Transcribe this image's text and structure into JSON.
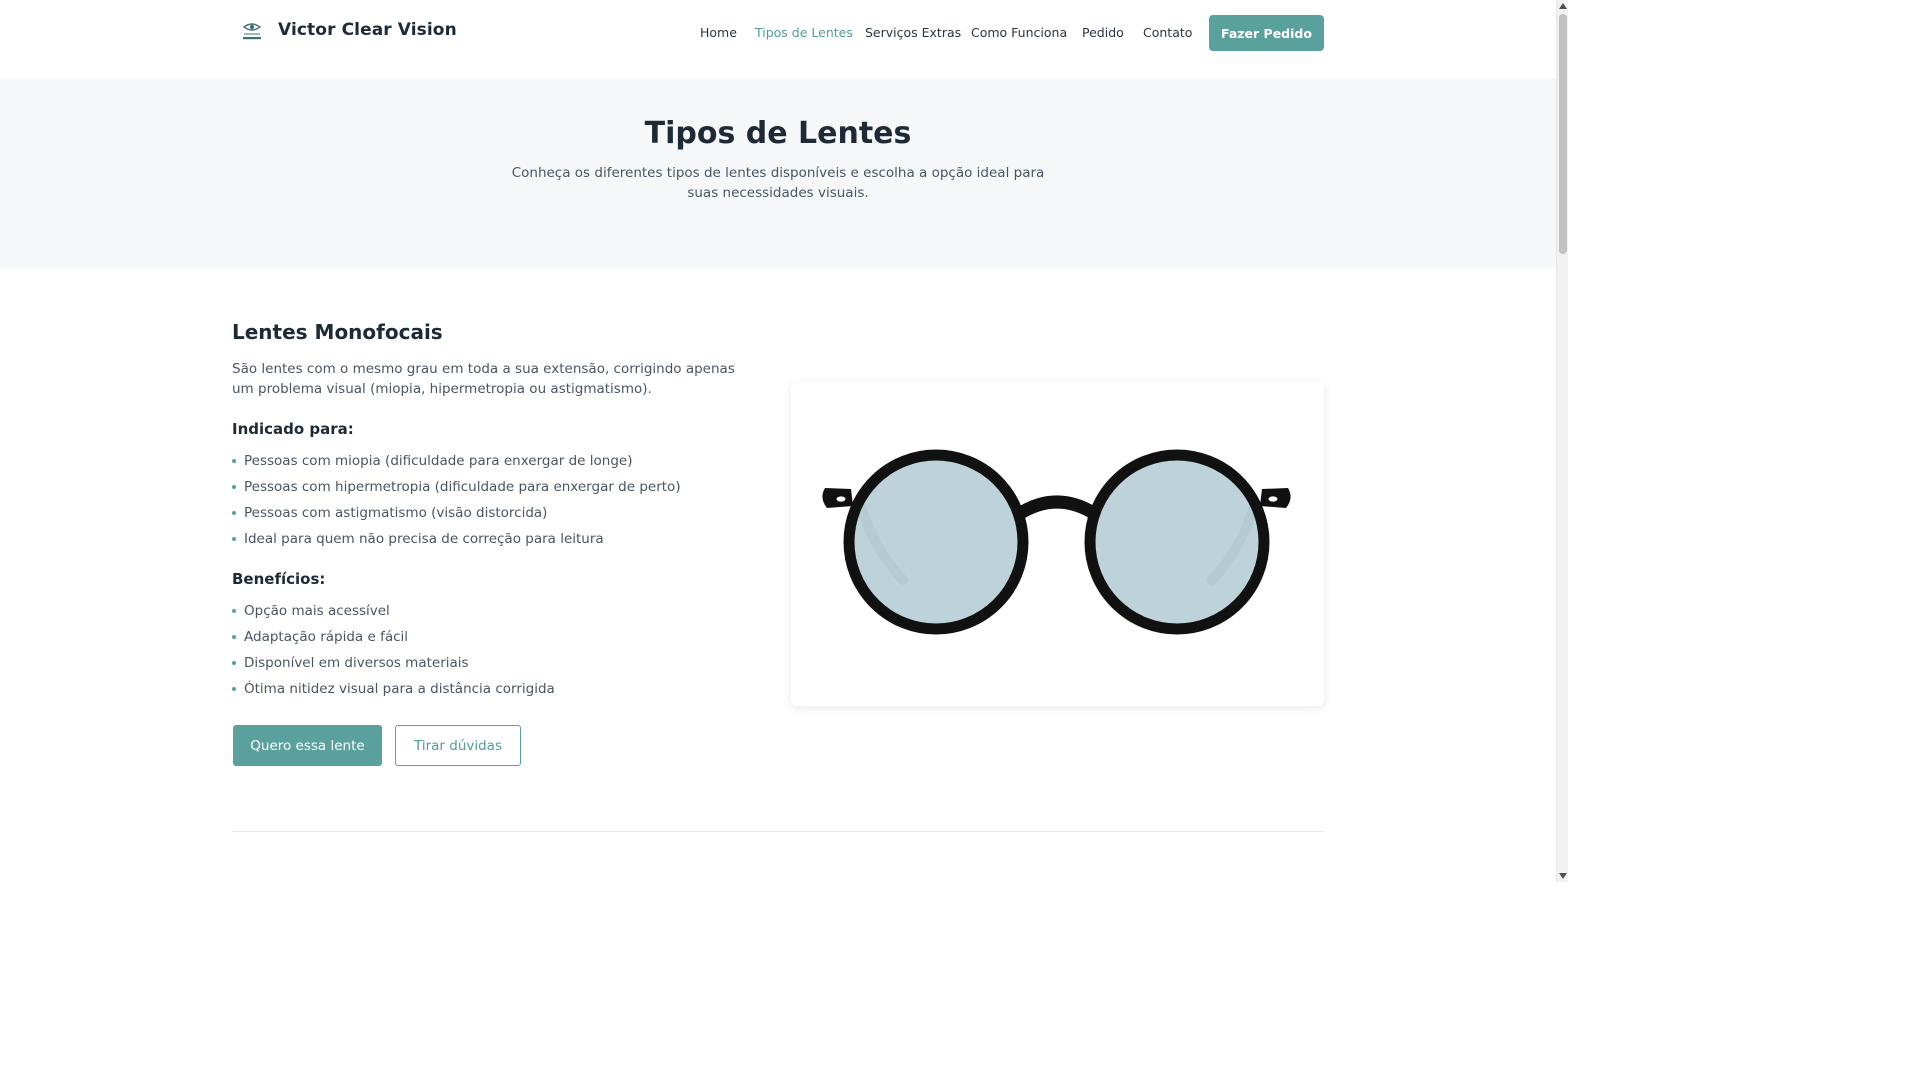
{
  "header": {
    "brand": "Victor Clear Vision",
    "logo_icon": "eye-logo-icon",
    "nav": [
      {
        "label": "Home",
        "active": false
      },
      {
        "label": "Tipos de Lentes",
        "active": true
      },
      {
        "label": "Serviços Extras",
        "active": false
      },
      {
        "label": "Como Funciona",
        "active": false
      },
      {
        "label": "Pedido",
        "active": false
      },
      {
        "label": "Contato",
        "active": false
      }
    ],
    "cta_label": "Fazer Pedido"
  },
  "hero": {
    "title": "Tipos de Lentes",
    "subtitle": "Conheça os diferentes tipos de lentes disponíveis e escolha a opção ideal para suas necessidades visuais."
  },
  "lens": {
    "title": "Lentes Monofocais",
    "description": "São lentes com o mesmo grau em toda a sua extensão, corrigindo apenas um problema visual (miopia, hipermetropia ou astigmatismo).",
    "indicated_heading": "Indicado para:",
    "indicated": [
      "Pessoas com miopia (dificuldade para enxergar de longe)",
      "Pessoas com hipermetropia (dificuldade para enxergar de perto)",
      "Pessoas com astigmatismo (visão distorcida)",
      "Ideal para quem não precisa de correção para leitura"
    ],
    "benefits_heading": "Benefícios:",
    "benefits": [
      "Opção mais acessível",
      "Adaptação rápida e fácil",
      "Disponível em diversos materiais",
      "Ótima nitidez visual para a distância corrigida"
    ],
    "primary_button": "Quero essa lente",
    "secondary_button": "Tirar dúvidas",
    "image_icon": "round-glasses-image"
  },
  "colors": {
    "accent": "#5aa09c",
    "text": "#1f2a37",
    "muted": "#4a5563",
    "hero_bg": "#f5f7f9"
  }
}
